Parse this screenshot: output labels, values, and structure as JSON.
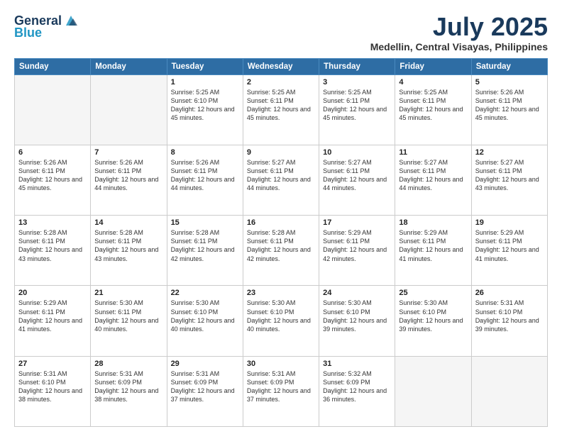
{
  "header": {
    "logo_general": "General",
    "logo_blue": "Blue",
    "month_title": "July 2025",
    "location": "Medellin, Central Visayas, Philippines"
  },
  "days_of_week": [
    "Sunday",
    "Monday",
    "Tuesday",
    "Wednesday",
    "Thursday",
    "Friday",
    "Saturday"
  ],
  "weeks": [
    [
      {
        "day": "",
        "info": ""
      },
      {
        "day": "",
        "info": ""
      },
      {
        "day": "1",
        "info": "Sunrise: 5:25 AM\nSunset: 6:10 PM\nDaylight: 12 hours and 45 minutes."
      },
      {
        "day": "2",
        "info": "Sunrise: 5:25 AM\nSunset: 6:11 PM\nDaylight: 12 hours and 45 minutes."
      },
      {
        "day": "3",
        "info": "Sunrise: 5:25 AM\nSunset: 6:11 PM\nDaylight: 12 hours and 45 minutes."
      },
      {
        "day": "4",
        "info": "Sunrise: 5:25 AM\nSunset: 6:11 PM\nDaylight: 12 hours and 45 minutes."
      },
      {
        "day": "5",
        "info": "Sunrise: 5:26 AM\nSunset: 6:11 PM\nDaylight: 12 hours and 45 minutes."
      }
    ],
    [
      {
        "day": "6",
        "info": "Sunrise: 5:26 AM\nSunset: 6:11 PM\nDaylight: 12 hours and 45 minutes."
      },
      {
        "day": "7",
        "info": "Sunrise: 5:26 AM\nSunset: 6:11 PM\nDaylight: 12 hours and 44 minutes."
      },
      {
        "day": "8",
        "info": "Sunrise: 5:26 AM\nSunset: 6:11 PM\nDaylight: 12 hours and 44 minutes."
      },
      {
        "day": "9",
        "info": "Sunrise: 5:27 AM\nSunset: 6:11 PM\nDaylight: 12 hours and 44 minutes."
      },
      {
        "day": "10",
        "info": "Sunrise: 5:27 AM\nSunset: 6:11 PM\nDaylight: 12 hours and 44 minutes."
      },
      {
        "day": "11",
        "info": "Sunrise: 5:27 AM\nSunset: 6:11 PM\nDaylight: 12 hours and 44 minutes."
      },
      {
        "day": "12",
        "info": "Sunrise: 5:27 AM\nSunset: 6:11 PM\nDaylight: 12 hours and 43 minutes."
      }
    ],
    [
      {
        "day": "13",
        "info": "Sunrise: 5:28 AM\nSunset: 6:11 PM\nDaylight: 12 hours and 43 minutes."
      },
      {
        "day": "14",
        "info": "Sunrise: 5:28 AM\nSunset: 6:11 PM\nDaylight: 12 hours and 43 minutes."
      },
      {
        "day": "15",
        "info": "Sunrise: 5:28 AM\nSunset: 6:11 PM\nDaylight: 12 hours and 42 minutes."
      },
      {
        "day": "16",
        "info": "Sunrise: 5:28 AM\nSunset: 6:11 PM\nDaylight: 12 hours and 42 minutes."
      },
      {
        "day": "17",
        "info": "Sunrise: 5:29 AM\nSunset: 6:11 PM\nDaylight: 12 hours and 42 minutes."
      },
      {
        "day": "18",
        "info": "Sunrise: 5:29 AM\nSunset: 6:11 PM\nDaylight: 12 hours and 41 minutes."
      },
      {
        "day": "19",
        "info": "Sunrise: 5:29 AM\nSunset: 6:11 PM\nDaylight: 12 hours and 41 minutes."
      }
    ],
    [
      {
        "day": "20",
        "info": "Sunrise: 5:29 AM\nSunset: 6:11 PM\nDaylight: 12 hours and 41 minutes."
      },
      {
        "day": "21",
        "info": "Sunrise: 5:30 AM\nSunset: 6:11 PM\nDaylight: 12 hours and 40 minutes."
      },
      {
        "day": "22",
        "info": "Sunrise: 5:30 AM\nSunset: 6:10 PM\nDaylight: 12 hours and 40 minutes."
      },
      {
        "day": "23",
        "info": "Sunrise: 5:30 AM\nSunset: 6:10 PM\nDaylight: 12 hours and 40 minutes."
      },
      {
        "day": "24",
        "info": "Sunrise: 5:30 AM\nSunset: 6:10 PM\nDaylight: 12 hours and 39 minutes."
      },
      {
        "day": "25",
        "info": "Sunrise: 5:30 AM\nSunset: 6:10 PM\nDaylight: 12 hours and 39 minutes."
      },
      {
        "day": "26",
        "info": "Sunrise: 5:31 AM\nSunset: 6:10 PM\nDaylight: 12 hours and 39 minutes."
      }
    ],
    [
      {
        "day": "27",
        "info": "Sunrise: 5:31 AM\nSunset: 6:10 PM\nDaylight: 12 hours and 38 minutes."
      },
      {
        "day": "28",
        "info": "Sunrise: 5:31 AM\nSunset: 6:09 PM\nDaylight: 12 hours and 38 minutes."
      },
      {
        "day": "29",
        "info": "Sunrise: 5:31 AM\nSunset: 6:09 PM\nDaylight: 12 hours and 37 minutes."
      },
      {
        "day": "30",
        "info": "Sunrise: 5:31 AM\nSunset: 6:09 PM\nDaylight: 12 hours and 37 minutes."
      },
      {
        "day": "31",
        "info": "Sunrise: 5:32 AM\nSunset: 6:09 PM\nDaylight: 12 hours and 36 minutes."
      },
      {
        "day": "",
        "info": ""
      },
      {
        "day": "",
        "info": ""
      }
    ]
  ]
}
